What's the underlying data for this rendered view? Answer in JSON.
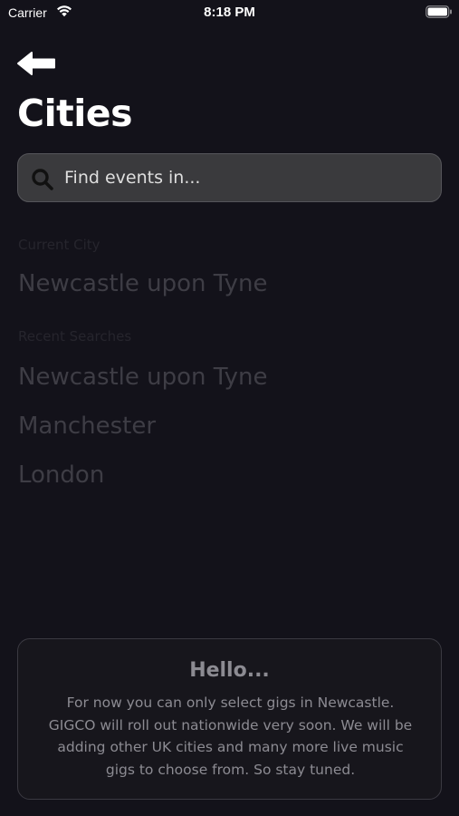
{
  "status_bar": {
    "carrier": "Carrier",
    "time": "8:18 PM"
  },
  "header": {
    "back_icon": "arrow-left-icon",
    "title": "Cities"
  },
  "search": {
    "icon": "search-icon",
    "placeholder": "Find events in..."
  },
  "current_city": {
    "label": "Current City",
    "city": "Newcastle upon Tyne"
  },
  "recent_searches": {
    "label": "Recent Searches",
    "items": [
      "Newcastle upon Tyne",
      "Manchester",
      "London"
    ]
  },
  "info_card": {
    "heading": "Hello...",
    "body": "For now you can only select gigs in Newcastle. GIGCO will roll out nationwide very soon. We will be adding other UK cities and many more live music gigs to choose from. So stay tuned."
  },
  "colors": {
    "background": "#13121a",
    "search_background": "#3a3a3d",
    "muted_text": "#3e3d45",
    "card_text": "#8c8b92"
  }
}
